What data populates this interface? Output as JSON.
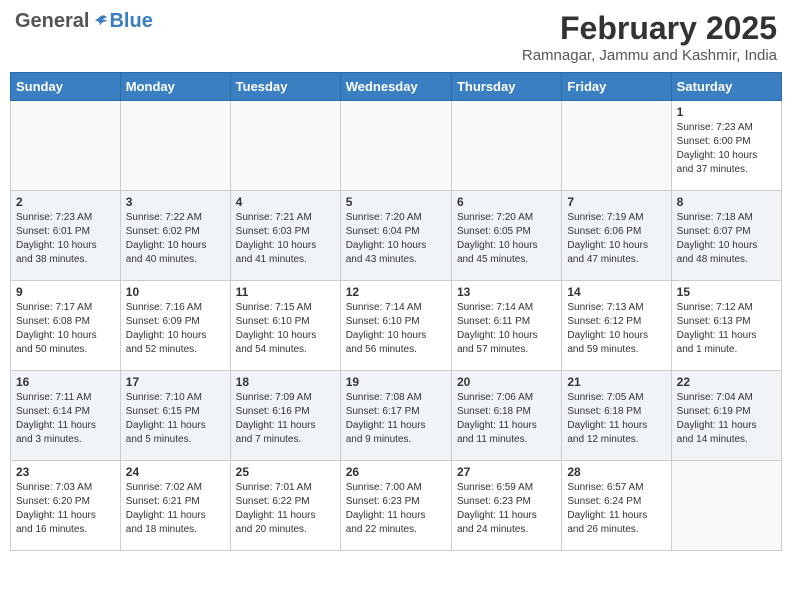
{
  "header": {
    "logo_general": "General",
    "logo_blue": "Blue",
    "month_title": "February 2025",
    "location": "Ramnagar, Jammu and Kashmir, India"
  },
  "weekdays": [
    "Sunday",
    "Monday",
    "Tuesday",
    "Wednesday",
    "Thursday",
    "Friday",
    "Saturday"
  ],
  "weeks": [
    {
      "days": [
        {
          "num": "",
          "info": ""
        },
        {
          "num": "",
          "info": ""
        },
        {
          "num": "",
          "info": ""
        },
        {
          "num": "",
          "info": ""
        },
        {
          "num": "",
          "info": ""
        },
        {
          "num": "",
          "info": ""
        },
        {
          "num": "1",
          "info": "Sunrise: 7:23 AM\nSunset: 6:00 PM\nDaylight: 10 hours\nand 37 minutes."
        }
      ]
    },
    {
      "days": [
        {
          "num": "2",
          "info": "Sunrise: 7:23 AM\nSunset: 6:01 PM\nDaylight: 10 hours\nand 38 minutes."
        },
        {
          "num": "3",
          "info": "Sunrise: 7:22 AM\nSunset: 6:02 PM\nDaylight: 10 hours\nand 40 minutes."
        },
        {
          "num": "4",
          "info": "Sunrise: 7:21 AM\nSunset: 6:03 PM\nDaylight: 10 hours\nand 41 minutes."
        },
        {
          "num": "5",
          "info": "Sunrise: 7:20 AM\nSunset: 6:04 PM\nDaylight: 10 hours\nand 43 minutes."
        },
        {
          "num": "6",
          "info": "Sunrise: 7:20 AM\nSunset: 6:05 PM\nDaylight: 10 hours\nand 45 minutes."
        },
        {
          "num": "7",
          "info": "Sunrise: 7:19 AM\nSunset: 6:06 PM\nDaylight: 10 hours\nand 47 minutes."
        },
        {
          "num": "8",
          "info": "Sunrise: 7:18 AM\nSunset: 6:07 PM\nDaylight: 10 hours\nand 48 minutes."
        }
      ]
    },
    {
      "days": [
        {
          "num": "9",
          "info": "Sunrise: 7:17 AM\nSunset: 6:08 PM\nDaylight: 10 hours\nand 50 minutes."
        },
        {
          "num": "10",
          "info": "Sunrise: 7:16 AM\nSunset: 6:09 PM\nDaylight: 10 hours\nand 52 minutes."
        },
        {
          "num": "11",
          "info": "Sunrise: 7:15 AM\nSunset: 6:10 PM\nDaylight: 10 hours\nand 54 minutes."
        },
        {
          "num": "12",
          "info": "Sunrise: 7:14 AM\nSunset: 6:10 PM\nDaylight: 10 hours\nand 56 minutes."
        },
        {
          "num": "13",
          "info": "Sunrise: 7:14 AM\nSunset: 6:11 PM\nDaylight: 10 hours\nand 57 minutes."
        },
        {
          "num": "14",
          "info": "Sunrise: 7:13 AM\nSunset: 6:12 PM\nDaylight: 10 hours\nand 59 minutes."
        },
        {
          "num": "15",
          "info": "Sunrise: 7:12 AM\nSunset: 6:13 PM\nDaylight: 11 hours\nand 1 minute."
        }
      ]
    },
    {
      "days": [
        {
          "num": "16",
          "info": "Sunrise: 7:11 AM\nSunset: 6:14 PM\nDaylight: 11 hours\nand 3 minutes."
        },
        {
          "num": "17",
          "info": "Sunrise: 7:10 AM\nSunset: 6:15 PM\nDaylight: 11 hours\nand 5 minutes."
        },
        {
          "num": "18",
          "info": "Sunrise: 7:09 AM\nSunset: 6:16 PM\nDaylight: 11 hours\nand 7 minutes."
        },
        {
          "num": "19",
          "info": "Sunrise: 7:08 AM\nSunset: 6:17 PM\nDaylight: 11 hours\nand 9 minutes."
        },
        {
          "num": "20",
          "info": "Sunrise: 7:06 AM\nSunset: 6:18 PM\nDaylight: 11 hours\nand 11 minutes."
        },
        {
          "num": "21",
          "info": "Sunrise: 7:05 AM\nSunset: 6:18 PM\nDaylight: 11 hours\nand 12 minutes."
        },
        {
          "num": "22",
          "info": "Sunrise: 7:04 AM\nSunset: 6:19 PM\nDaylight: 11 hours\nand 14 minutes."
        }
      ]
    },
    {
      "days": [
        {
          "num": "23",
          "info": "Sunrise: 7:03 AM\nSunset: 6:20 PM\nDaylight: 11 hours\nand 16 minutes."
        },
        {
          "num": "24",
          "info": "Sunrise: 7:02 AM\nSunset: 6:21 PM\nDaylight: 11 hours\nand 18 minutes."
        },
        {
          "num": "25",
          "info": "Sunrise: 7:01 AM\nSunset: 6:22 PM\nDaylight: 11 hours\nand 20 minutes."
        },
        {
          "num": "26",
          "info": "Sunrise: 7:00 AM\nSunset: 6:23 PM\nDaylight: 11 hours\nand 22 minutes."
        },
        {
          "num": "27",
          "info": "Sunrise: 6:59 AM\nSunset: 6:23 PM\nDaylight: 11 hours\nand 24 minutes."
        },
        {
          "num": "28",
          "info": "Sunrise: 6:57 AM\nSunset: 6:24 PM\nDaylight: 11 hours\nand 26 minutes."
        },
        {
          "num": "",
          "info": ""
        }
      ]
    }
  ]
}
